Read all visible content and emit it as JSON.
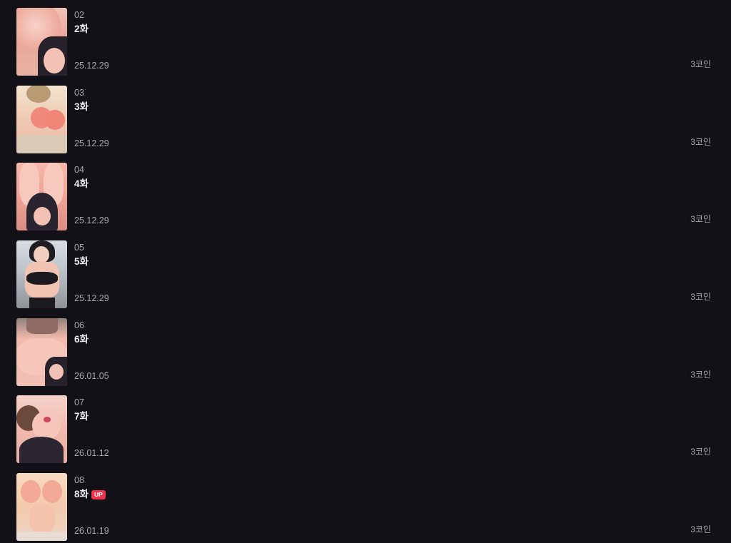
{
  "episodes": [
    {
      "number": "02",
      "title": "2화",
      "date": "25.12.29",
      "price": "3코인",
      "thumbnail": "episode-2-cover",
      "badge": ""
    },
    {
      "number": "03",
      "title": "3화",
      "date": "25.12.29",
      "price": "3코인",
      "thumbnail": "episode-3-cover",
      "badge": ""
    },
    {
      "number": "04",
      "title": "4화",
      "date": "25.12.29",
      "price": "3코인",
      "thumbnail": "episode-4-cover",
      "badge": ""
    },
    {
      "number": "05",
      "title": "5화",
      "date": "25.12.29",
      "price": "3코인",
      "thumbnail": "episode-5-cover",
      "badge": ""
    },
    {
      "number": "06",
      "title": "6화",
      "date": "26.01.05",
      "price": "3코인",
      "thumbnail": "episode-6-cover",
      "badge": ""
    },
    {
      "number": "07",
      "title": "7화",
      "date": "26.01.12",
      "price": "3코인",
      "thumbnail": "episode-7-cover",
      "badge": ""
    },
    {
      "number": "08",
      "title": "8화",
      "date": "26.01.19",
      "price": "3코인",
      "thumbnail": "episode-8-cover",
      "badge": "UP"
    }
  ],
  "colors": {
    "background": "#121117",
    "text_primary": "#ececf1",
    "text_secondary": "#a8a7ad",
    "badge": "#f0334d"
  }
}
